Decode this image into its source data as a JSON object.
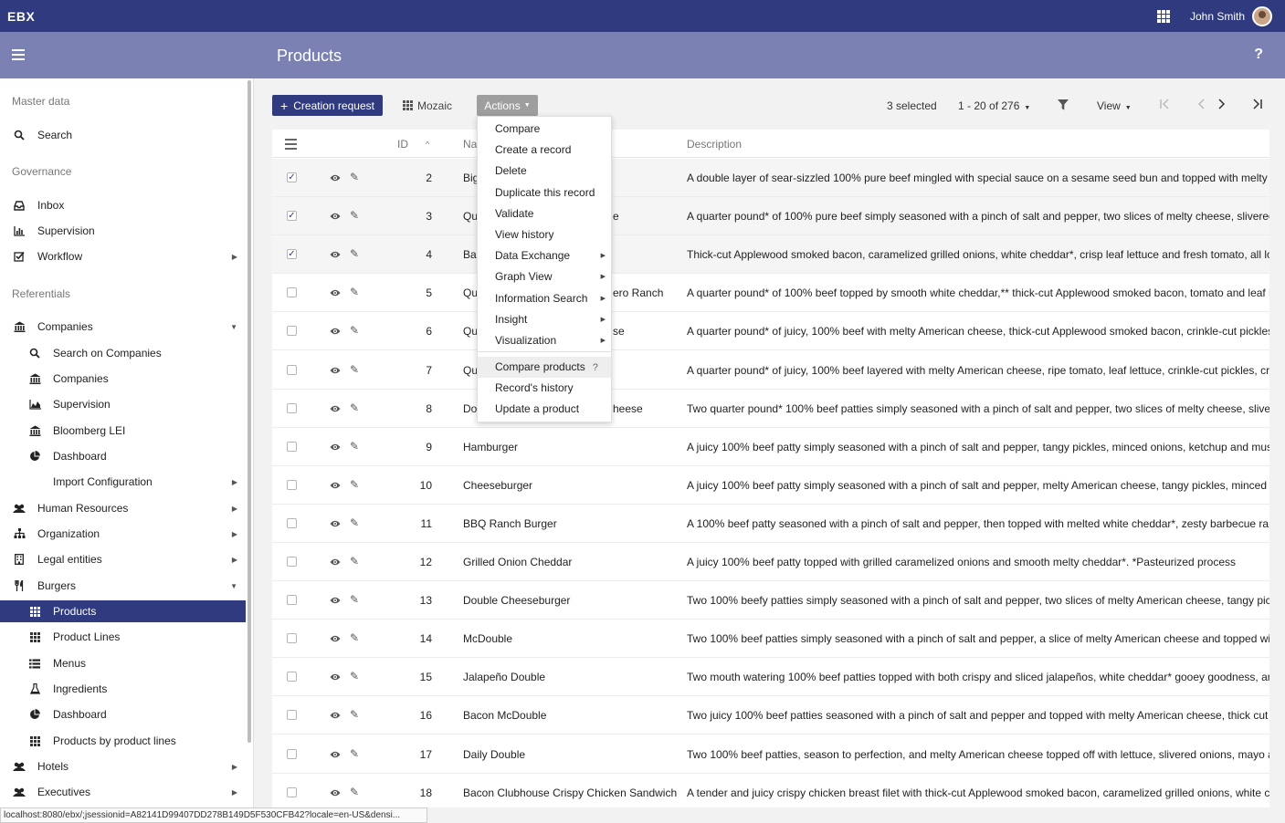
{
  "app": {
    "brand": "EBX",
    "user": "John Smith",
    "page_title": "Products",
    "help": "?"
  },
  "sidebar": {
    "sections": [
      "Master data",
      "Governance",
      "Referentials"
    ],
    "master": [
      {
        "label": "Search",
        "icon": "search-icon"
      }
    ],
    "governance": [
      {
        "label": "Inbox",
        "icon": "inbox-icon"
      },
      {
        "label": "Supervision",
        "icon": "bar-chart-icon"
      },
      {
        "label": "Workflow",
        "icon": "checkbox-icon"
      }
    ],
    "referentials": [
      {
        "label": "Companies",
        "icon": "bank-icon"
      },
      {
        "label": "Search on Companies",
        "icon": "search-icon"
      },
      {
        "label": "Companies",
        "icon": "bank-icon"
      },
      {
        "label": "Supervision",
        "icon": "area-chart-icon"
      },
      {
        "label": "Bloomberg LEI",
        "icon": "bank-icon"
      },
      {
        "label": "Dashboard",
        "icon": "pie-chart-icon"
      },
      {
        "label": "Import Configuration",
        "icon": ""
      },
      {
        "label": "Human Resources",
        "icon": "users-icon"
      },
      {
        "label": "Organization",
        "icon": "org-chart-icon"
      },
      {
        "label": "Legal entities",
        "icon": "building-icon"
      },
      {
        "label": "Burgers",
        "icon": "cutlery-icon"
      },
      {
        "label": "Products",
        "icon": "grid-icon"
      },
      {
        "label": "Product Lines",
        "icon": "grid-icon"
      },
      {
        "label": "Menus",
        "icon": "list-icon"
      },
      {
        "label": "Ingredients",
        "icon": "flask-icon"
      },
      {
        "label": "Dashboard",
        "icon": "pie-chart-icon"
      },
      {
        "label": "Products by product lines",
        "icon": "grid-icon"
      },
      {
        "label": "Hotels",
        "icon": "users-icon"
      },
      {
        "label": "Executives",
        "icon": "users-icon"
      }
    ]
  },
  "toolbar": {
    "creation_request": "Creation request",
    "mozaic": "Mozaic",
    "actions": "Actions",
    "selected": "3 selected",
    "pagination": "1 - 20 of 276",
    "view": "View"
  },
  "table": {
    "headers": {
      "id": "ID",
      "name": "Na",
      "description": "Description"
    },
    "rows": [
      {
        "id": "2",
        "name": "Big",
        "desc": "A double layer of sear-sizzled 100% pure beef mingled with special sauce on a sesame seed bun and topped with melty Amer",
        "checked": "✓"
      },
      {
        "id": "3",
        "name": "Qu",
        "desc": "A quarter pound* of 100% pure beef simply seasoned with a pinch of salt and pepper, two slices of melty cheese, slivered on",
        "checked": "✓"
      },
      {
        "id": "4",
        "name": "Ba",
        "desc": "Thick-cut Applewood smoked bacon, caramelized grilled onions, white cheddar*, crisp leaf lettuce and fresh tomato, all loving",
        "checked": "✓"
      },
      {
        "id": "5",
        "name": "Qu",
        "desc": "A quarter pound* of 100% beef topped by smooth white cheddar,** thick-cut Applewood smoked bacon, tomato and leaf let",
        "checked": ""
      },
      {
        "id": "6",
        "name": "Qu",
        "desc": "A quarter pound* of juicy, 100% beef with melty American cheese, thick-cut Applewood smoked bacon, crinkle-cut pickles, c",
        "checked": ""
      },
      {
        "id": "7",
        "name": "Qu",
        "desc": "A quarter pound* of juicy, 100% beef layered with melty American cheese, ripe tomato, leaf lettuce, crinkle-cut pickles, crunc",
        "checked": ""
      },
      {
        "id": "8",
        "name": "Do",
        "desc": "Two quarter pound* 100% beef patties simply seasoned with a pinch of salt and pepper, two slices of melty cheese, slivered o",
        "checked": ""
      },
      {
        "id": "9",
        "name": "Hamburger",
        "desc": "A juicy 100% beef patty simply seasoned with a pinch of salt and pepper, tangy pickles, minced onions, ketchup and mustard",
        "checked": ""
      },
      {
        "id": "10",
        "name": "Cheeseburger",
        "desc": "A juicy 100% beef patty simply seasoned with a pinch of salt and pepper, melty American cheese, tangy pickles, minced onio",
        "checked": ""
      },
      {
        "id": "11",
        "name": "BBQ Ranch Burger",
        "desc": "A 100% beef patty seasoned with a pinch of salt and pepper, then topped with melted white cheddar*, zesty barbecue ranch",
        "checked": ""
      },
      {
        "id": "12",
        "name": "Grilled Onion Cheddar",
        "desc": "A juicy 100% beef patty topped with grilled caramelized onions and smooth melty cheddar*. *Pasteurized process",
        "checked": ""
      },
      {
        "id": "13",
        "name": "Double Cheeseburger",
        "desc": "Two 100% beefy patties simply seasoned with a pinch of salt and pepper, two slices of melty American cheese, tangy pickles,",
        "checked": ""
      },
      {
        "id": "14",
        "name": "McDouble",
        "desc": "Two 100% beef patties simply seasoned with a pinch of salt and pepper, a slice of melty American cheese and topped with ta",
        "checked": ""
      },
      {
        "id": "15",
        "name": "Jalapeño Double",
        "desc": "Two mouth watering 100% beef patties topped with both crispy and sliced jalapeños, white cheddar* gooey goodness, and o",
        "checked": ""
      },
      {
        "id": "16",
        "name": "Bacon McDouble",
        "desc": "Two juicy 100% beef patties seasoned with a pinch of salt and pepper and topped with melty American cheese, thick cut App",
        "checked": ""
      },
      {
        "id": "17",
        "name": "Daily Double",
        "desc": "Two 100% beef patties, season to perfection, and melty American cheese topped off with lettuce, slivered onions, mayo and",
        "checked": ""
      },
      {
        "id": "18",
        "name": "Bacon Clubhouse Crispy Chicken Sandwich",
        "desc": "A tender and juicy crispy chicken breast filet with thick-cut Applewood smoked bacon, caramelized grilled onions, white ched",
        "checked": ""
      }
    ],
    "name_overflow": [
      "",
      "e",
      "",
      "ero Ranch",
      "se",
      "",
      "heese"
    ]
  },
  "menu": {
    "items": [
      {
        "label": "Compare",
        "sub": ""
      },
      {
        "label": "Create a record",
        "sub": ""
      },
      {
        "label": "Delete",
        "sub": ""
      },
      {
        "label": "Duplicate this record",
        "sub": ""
      },
      {
        "label": "Validate",
        "sub": ""
      },
      {
        "label": "View history",
        "sub": ""
      },
      {
        "label": "Data Exchange",
        "sub": "▶"
      },
      {
        "label": "Graph View",
        "sub": "▶"
      },
      {
        "label": "Information Search",
        "sub": "▶"
      },
      {
        "label": "Insight",
        "sub": "▶"
      },
      {
        "label": "Visualization",
        "sub": "▶"
      }
    ],
    "items2": [
      {
        "label": "Compare products",
        "help": "?"
      },
      {
        "label": "Record's history",
        "help": ""
      },
      {
        "label": "Update a product",
        "help": ""
      }
    ]
  },
  "status_url": "localhost:8080/ebx/;jsessionid=A82141D99407DD278B149D5F530CFB42?locale=en-US&densi...",
  "colors": {
    "brand": "#2f3b7e",
    "header": "#7b82b3",
    "actions": "#9e9e9e"
  }
}
